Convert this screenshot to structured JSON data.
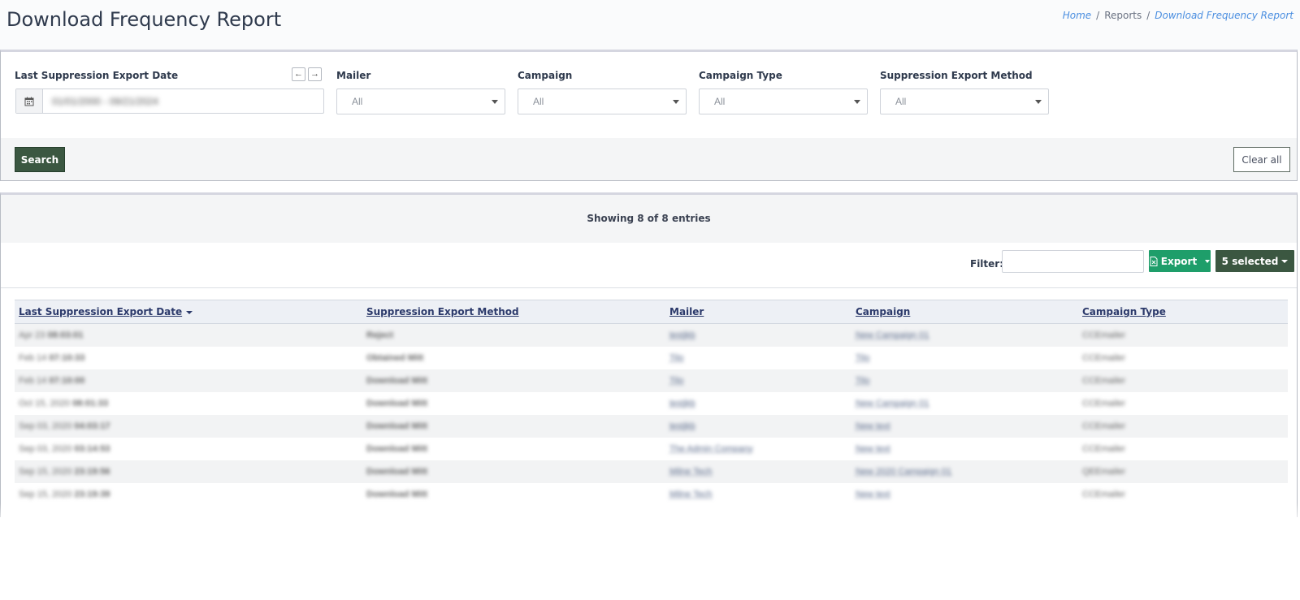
{
  "page": {
    "title": "Download Frequency Report"
  },
  "breadcrumb": {
    "home": "Home",
    "sep1": "/",
    "reports": "Reports",
    "sep2": "/",
    "current": "Download Frequency Report"
  },
  "filters": {
    "date_label": "Last Suppression Export Date",
    "date_value": "01/01/2000 - 09/21/2024",
    "prev_icon": "arrow-left-icon",
    "next_icon": "arrow-right-icon",
    "calendar_icon": "calendar-icon",
    "mailer": {
      "label": "Mailer",
      "value": "All"
    },
    "campaign": {
      "label": "Campaign",
      "value": "All"
    },
    "campaign_type": {
      "label": "Campaign Type",
      "value": "All"
    },
    "export_method": {
      "label": "Suppression Export Method",
      "value": "All"
    },
    "search_label": "Search",
    "clear_label": "Clear all"
  },
  "results": {
    "showing": "Showing 8 of 8 entries",
    "filter_label": "Filter:",
    "filter_value": "",
    "export_label": "Export",
    "export_icon": "file-excel-icon",
    "selected_label": "5 selected"
  },
  "table": {
    "columns": [
      "Last Suppression Export Date",
      "Suppression Export Method",
      "Mailer",
      "Campaign",
      "Campaign Type"
    ],
    "rows": [
      {
        "date": "Apr 23",
        "time": "08:03:01",
        "method": "Reject",
        "mailer": "testjkb",
        "campaign": "New Campaign 01",
        "type": "CCEmailer"
      },
      {
        "date": "Feb 14",
        "time": "07:10:33",
        "method": "Obtained Mitt",
        "mailer": "Tilo",
        "campaign": "Tilo",
        "type": "CCEmailer"
      },
      {
        "date": "Feb 14",
        "time": "07:10:00",
        "method": "Download Mitt",
        "mailer": "Tilo",
        "campaign": "Tilo",
        "type": "CCEmailer"
      },
      {
        "date": "Oct 15, 2020",
        "time": "08:01:33",
        "method": "Download Mitt",
        "mailer": "testjkb",
        "campaign": "New Campaign 01",
        "type": "CCEmailer"
      },
      {
        "date": "Sep 03, 2020",
        "time": "04:03:17",
        "method": "Download Mitt",
        "mailer": "testjkb",
        "campaign": "New text",
        "type": "CCEmailer"
      },
      {
        "date": "Sep 03, 2020",
        "time": "03:14:53",
        "method": "Download Mitt",
        "mailer": "The Admin Company",
        "campaign": "New text",
        "type": "CCEmailer"
      },
      {
        "date": "Sep 15, 2020",
        "time": "23:19:56",
        "method": "Download Mitt",
        "mailer": "Milne Tech",
        "campaign": "New 2020 Campaign 01",
        "type": "QEEmailer"
      },
      {
        "date": "Sep 15, 2020",
        "time": "23:19:39",
        "method": "Download Mitt",
        "mailer": "Milne Tech",
        "campaign": "New text",
        "type": "CCEmailer"
      }
    ]
  }
}
